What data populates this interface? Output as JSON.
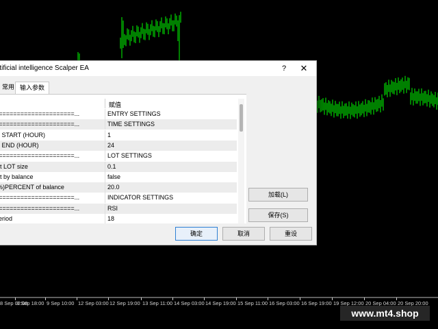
{
  "dialog": {
    "title": "rtificial intelligence Scalper EA",
    "help_symbol": "?",
    "close_symbol": "✕",
    "tabs": [
      "常用",
      "输入参数"
    ],
    "value_header": "赋值",
    "params": [
      {
        "name": "======================...",
        "value": "ENTRY SETTINGS"
      },
      {
        "name": "======================...",
        "value": "TIME SETTINGS"
      },
      {
        "name": "le START (HOUR)",
        "value": "1"
      },
      {
        "name": "le END (HOUR)",
        "value": "24"
      },
      {
        "name": "======================...",
        "value": "LOT SETTINGS"
      },
      {
        "name": "ult LOT size",
        "value": "0.1"
      },
      {
        "name": "lot by balance",
        "value": "false"
      },
      {
        "name": "(%)PERCENT of balance",
        "value": "20.0"
      },
      {
        "name": "======================...",
        "value": "INDICATOR SETTINGS"
      },
      {
        "name": "======================...",
        "value": "RSI"
      },
      {
        "name": "period",
        "value": "18"
      }
    ],
    "buttons": {
      "load": "加载(L)",
      "save": "保存(S)",
      "ok": "确定",
      "cancel": "取消",
      "reset": "重设"
    }
  },
  "chart": {
    "candle_color": "#00ff00",
    "background": "#000000",
    "time_labels": [
      "8 Sep 02:00",
      "8 Sep 18:00",
      "9 Sep 10:00",
      "12 Sep 03:00",
      "12 Sep 19:00",
      "13 Sep 11:00",
      "14 Sep 03:00",
      "14 Sep 19:00",
      "15 Sep 11:00",
      "16 Sep 03:00",
      "16 Sep 19:00",
      "19 Sep 12:00",
      "20 Sep 04:00",
      "20 Sep 20:00"
    ]
  },
  "watermark": "www.mt4.shop"
}
